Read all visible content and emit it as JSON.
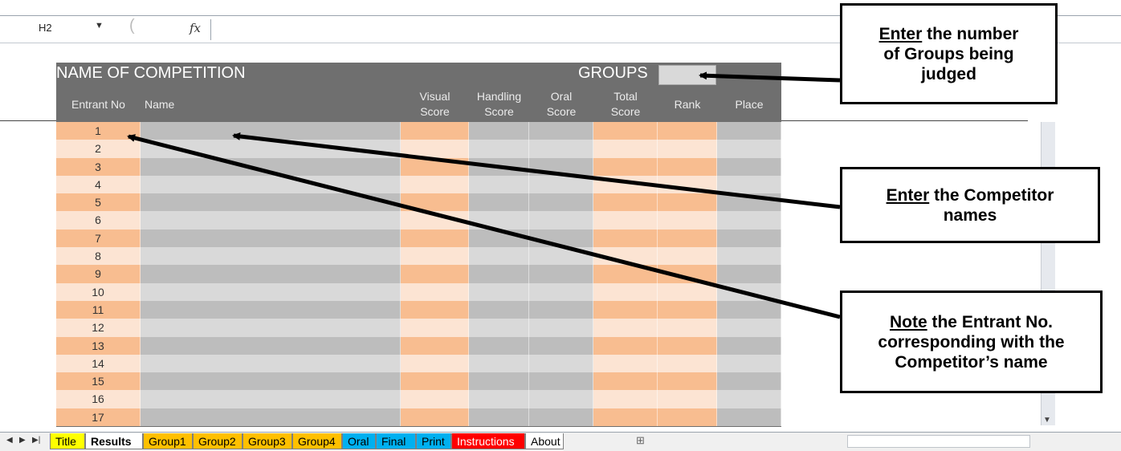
{
  "formula_bar": {
    "cell_ref": "H2",
    "fx": "fx"
  },
  "sheet": {
    "title": "NAME OF COMPETITION",
    "groups_label": "GROUPS",
    "columns": [
      {
        "label": "Entrant No"
      },
      {
        "label": "Name"
      },
      {
        "label": "Visual\nScore"
      },
      {
        "label": "Handling\nScore"
      },
      {
        "label": "Oral\nScore"
      },
      {
        "label": "Total\nScore"
      },
      {
        "label": "Rank"
      },
      {
        "label": "Place"
      }
    ],
    "entrants": [
      "1",
      "2",
      "3",
      "4",
      "5",
      "6",
      "7",
      "8",
      "9",
      "10",
      "11",
      "12",
      "13",
      "14",
      "15",
      "16",
      "17"
    ]
  },
  "tabs": [
    {
      "label": "Title",
      "color": "#ffff00"
    },
    {
      "label": "Results",
      "color": "#ffffff",
      "active": true
    },
    {
      "label": "Group1",
      "color": "#ffc000"
    },
    {
      "label": "Group2",
      "color": "#ffc000"
    },
    {
      "label": "Group3",
      "color": "#ffc000"
    },
    {
      "label": "Group4",
      "color": "#ffc000"
    },
    {
      "label": "Oral",
      "color": "#00b0f0"
    },
    {
      "label": "Final",
      "color": "#00b0f0"
    },
    {
      "label": "Print",
      "color": "#00b0f0"
    },
    {
      "label": "Instructions",
      "color": "#ff0000"
    },
    {
      "label": "About",
      "color": "#ffffff"
    }
  ],
  "callouts": {
    "groups": {
      "emph": "Enter",
      "rest1": " the number",
      "line2": "of Groups being",
      "line3": "judged"
    },
    "names": {
      "emph": "Enter",
      "rest1": " the Competitor",
      "line2": "names"
    },
    "entrant": {
      "emph": "Note",
      "rest1": " the Entrant No.",
      "line2": "corresponding with the",
      "line3": "Competitor’s name"
    }
  }
}
